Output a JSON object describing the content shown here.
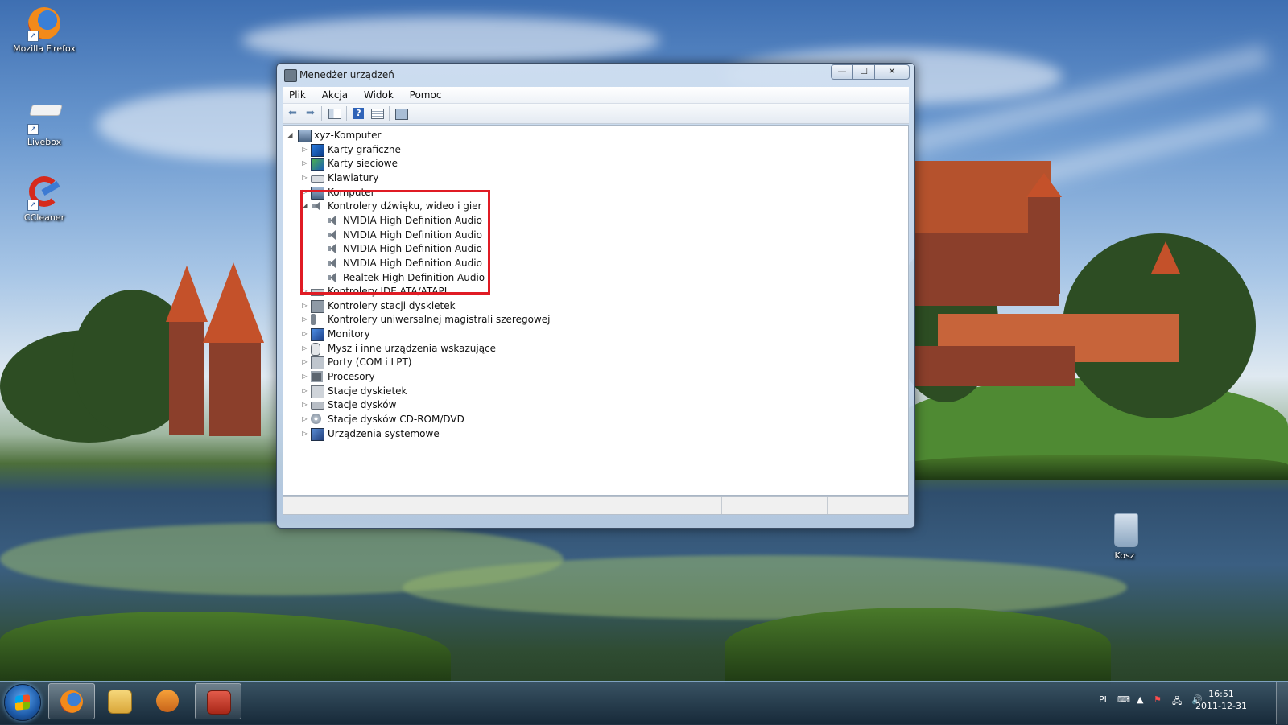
{
  "desktop": {
    "icons": [
      {
        "label": "Mozilla Firefox"
      },
      {
        "label": "Livebox"
      },
      {
        "label": "CCleaner"
      },
      {
        "label": "Kosz"
      }
    ]
  },
  "window": {
    "title": "Menedżer urządzeń",
    "controls": {
      "minimize": "—",
      "maximize": "☐",
      "close": "✕"
    },
    "menu": [
      "Plik",
      "Akcja",
      "Widok",
      "Pomoc"
    ],
    "toolbar_icons": [
      "back-arrow-icon",
      "forward-arrow-icon",
      "properties-pane-icon",
      "help-icon",
      "details-view-icon",
      "scan-hardware-icon"
    ],
    "tree": {
      "root": "xyz-Komputer",
      "items": [
        {
          "label": "Karty graficzne",
          "icon": "display-adapter-icon",
          "expanded": false
        },
        {
          "label": "Karty sieciowe",
          "icon": "network-adapter-icon",
          "expanded": false
        },
        {
          "label": "Klawiatury",
          "icon": "keyboard-icon",
          "expanded": false
        },
        {
          "label": "Komputer",
          "icon": "computer-icon",
          "expanded": false
        },
        {
          "label": "Kontrolery dźwięku, wideo i gier",
          "icon": "speaker-icon",
          "expanded": true,
          "children": [
            "NVIDIA High Definition Audio",
            "NVIDIA High Definition Audio",
            "NVIDIA High Definition Audio",
            "NVIDIA High Definition Audio",
            "Realtek High Definition Audio"
          ]
        },
        {
          "label": "Kontrolery IDE ATA/ATAPI",
          "icon": "ide-controller-icon",
          "expanded": false
        },
        {
          "label": "Kontrolery stacji dyskietek",
          "icon": "floppy-controller-icon",
          "expanded": false
        },
        {
          "label": "Kontrolery uniwersalnej magistrali szeregowej",
          "icon": "usb-icon",
          "expanded": false
        },
        {
          "label": "Monitory",
          "icon": "monitor-icon",
          "expanded": false
        },
        {
          "label": "Mysz i inne urządzenia wskazujące",
          "icon": "mouse-icon",
          "expanded": false
        },
        {
          "label": "Porty (COM i LPT)",
          "icon": "port-icon",
          "expanded": false
        },
        {
          "label": "Procesory",
          "icon": "processor-icon",
          "expanded": false
        },
        {
          "label": "Stacje dyskietek",
          "icon": "floppy-drive-icon",
          "expanded": false
        },
        {
          "label": "Stacje dysków",
          "icon": "disk-drive-icon",
          "expanded": false
        },
        {
          "label": "Stacje dysków CD-ROM/DVD",
          "icon": "cdrom-icon",
          "expanded": false
        },
        {
          "label": "Urządzenia systemowe",
          "icon": "system-devices-icon",
          "expanded": false
        }
      ]
    }
  },
  "taskbar": {
    "language": "PL",
    "time": "16:51",
    "date": "2011-12-31",
    "pinned": [
      "firefox-icon",
      "explorer-icon",
      "media-player-icon",
      "toolbox-icon"
    ]
  },
  "colors": {
    "highlight": "#e01b24",
    "taskbar": "#1c3248",
    "window_frame": "#b9cde4"
  }
}
